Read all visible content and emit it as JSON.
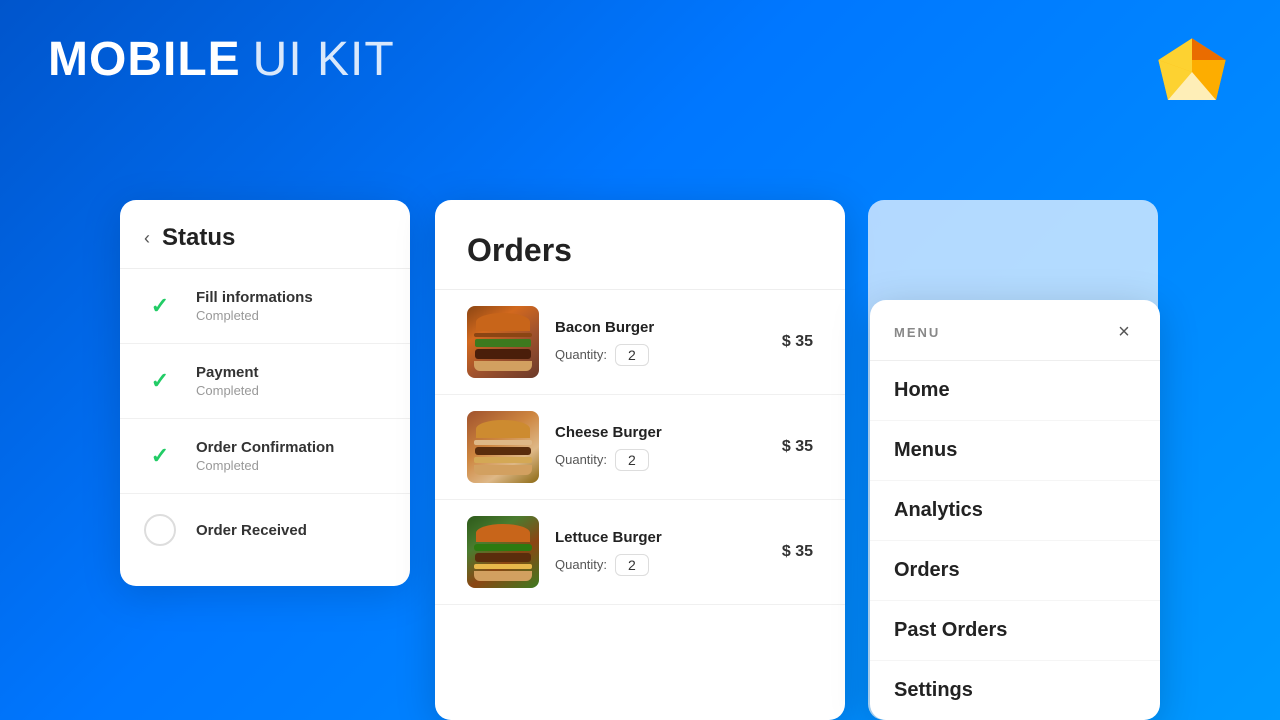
{
  "header": {
    "title_bold": "MOBILE",
    "title_light": "UI KIT"
  },
  "status_card": {
    "title": "Status",
    "back_arrow": "‹",
    "items": [
      {
        "label": "Fill informations",
        "sublabel": "Completed",
        "state": "completed"
      },
      {
        "label": "Payment",
        "sublabel": "Completed",
        "state": "completed"
      },
      {
        "label": "Order Confirmation",
        "sublabel": "Completed",
        "state": "completed"
      },
      {
        "label": "Order Received",
        "sublabel": "",
        "state": "pending"
      }
    ]
  },
  "orders_card": {
    "title": "Orders",
    "items": [
      {
        "name": "Bacon Burger",
        "qty_label": "Quantity:",
        "qty": "2",
        "price": "$ 35",
        "img_type": "bacon"
      },
      {
        "name": "Cheese Burger",
        "qty_label": "Quantity:",
        "qty": "2",
        "price": "$ 35",
        "img_type": "cheese"
      },
      {
        "name": "Lettuce Burger",
        "qty_label": "Quantity:",
        "qty": "2",
        "price": "$ 35",
        "img_type": "lettuce"
      }
    ]
  },
  "menu_card": {
    "label": "MENU",
    "close": "×",
    "items": [
      "Home",
      "Menus",
      "Analytics",
      "Orders",
      "Past Orders",
      "Settings"
    ]
  }
}
